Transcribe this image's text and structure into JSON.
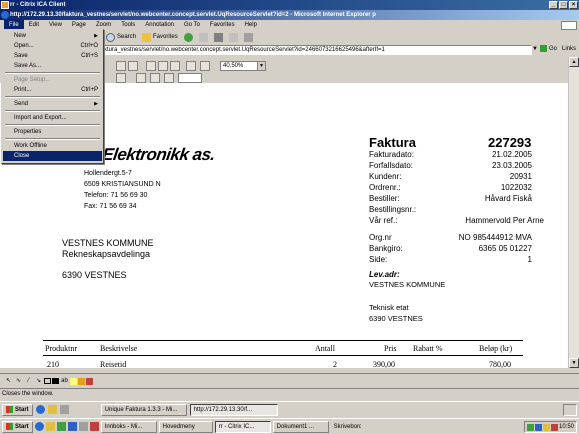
{
  "citrix_window": {
    "title": "rr - Citrix ICA Client"
  },
  "ie_window": {
    "title": "http://172.29.13.30/faktura_vestnes/servlet/no.webcenter.concept.servlet.UqResourceServlet?id=2 - Microsoft Internet Explorer p"
  },
  "menubar": {
    "items": [
      "File",
      "Edit",
      "View",
      "Page",
      "Zoom",
      "Tools",
      "Annotation",
      "Go To",
      "Favorites",
      "Help"
    ]
  },
  "toolbar": {
    "search_label": "Search",
    "favorites_label": "Favorites"
  },
  "address": {
    "url": "ktura_vestnes/servlet/no.webcenter.concept.servlet.UqResourceServlet?id=2466073216625496&afterIf=1",
    "go_label": "Go",
    "links_label": "Links"
  },
  "viewer": {
    "zoom_value": "40,50%"
  },
  "file_menu": {
    "items": [
      {
        "label": "New",
        "shortcut": "",
        "submenu": true,
        "disabled": false
      },
      {
        "label": "Open...",
        "shortcut": "Ctrl+O",
        "submenu": false,
        "disabled": false
      },
      {
        "label": "Save",
        "shortcut": "Ctrl+S",
        "submenu": false,
        "disabled": false
      },
      {
        "label": "Save As...",
        "shortcut": "",
        "submenu": false,
        "disabled": false
      },
      {
        "sep": true
      },
      {
        "label": "Page Setup...",
        "shortcut": "",
        "submenu": false,
        "disabled": true
      },
      {
        "label": "Print...",
        "shortcut": "Ctrl+P",
        "submenu": false,
        "disabled": false
      },
      {
        "sep": true
      },
      {
        "label": "Send",
        "shortcut": "",
        "submenu": true,
        "disabled": false
      },
      {
        "sep": true
      },
      {
        "label": "Import and Export...",
        "shortcut": "",
        "submenu": false,
        "disabled": false
      },
      {
        "sep": true
      },
      {
        "label": "Properties",
        "shortcut": "",
        "submenu": false,
        "disabled": false
      },
      {
        "sep": true
      },
      {
        "label": "Work Offline",
        "shortcut": "",
        "submenu": false,
        "disabled": false
      },
      {
        "label": "Close",
        "shortcut": "",
        "submenu": false,
        "disabled": false,
        "highlight": true
      }
    ]
  },
  "invoice": {
    "company_name": "dstoi Elektronikk as.",
    "company_address": [
      "Hollendergt.5-7",
      "6509  KRISTIANSUND N",
      "Telefon: 71 56 69 30",
      "Fax:       71 56 69 34"
    ],
    "customer": [
      "VESTNES KOMMUNE",
      "Rekneskapsavdelinga",
      "",
      "6390  VESTNES"
    ],
    "title": "Faktura",
    "number": "227293",
    "fields": [
      {
        "label": "Fakturadato:",
        "value": "21.02.2005"
      },
      {
        "label": "Forfallsdato:",
        "value": "23.03.2005"
      },
      {
        "label": "Kundenr:",
        "value": "20931"
      },
      {
        "label": "Ordrenr.:",
        "value": "1022032"
      },
      {
        "label": "Bestiller:",
        "value": "Håvard Fiskå"
      },
      {
        "label": "Bestillingsnr.:",
        "value": ""
      },
      {
        "label": "Vår ref.:",
        "value": "Hammervold Per Arne"
      },
      {
        "label": "",
        "value": ""
      },
      {
        "label": "Org.nr",
        "value": "NO 985444912 MVA"
      },
      {
        "label": "Bankgiro:",
        "value": "6365 05 01227"
      },
      {
        "label": "Side:",
        "value": "1"
      }
    ],
    "delivery_label": "Lev.adr:",
    "delivery": [
      "VESTNES KOMMUNE",
      "",
      "Teknisk etat",
      "6390  VESTNES"
    ],
    "table_headers": [
      "Produktnr",
      "Beskrivelse",
      "Antall",
      "Pris",
      "Rabatt %",
      "Beløp (kr)"
    ],
    "table_rows": [
      {
        "produktnr": "210",
        "beskrivelse": "Reisetid",
        "antall": "2",
        "pris": "390,00",
        "rabatt": "",
        "belop": "780,00"
      }
    ]
  },
  "statusbar": {
    "text": "Closes the window."
  },
  "taskbar1": {
    "start_label": "Start",
    "buttons": [
      "Unique Faktura 1.3.3 - Mi...",
      "http://172.29.13.30/f..."
    ]
  },
  "taskbar2": {
    "start_label": "Start",
    "buttons": [
      "Innboks - Mi...",
      "Hovedmeny",
      "rr - Citrix IC...",
      "Dokument1 ...",
      "Skrivebord"
    ],
    "clock": "10:50"
  }
}
